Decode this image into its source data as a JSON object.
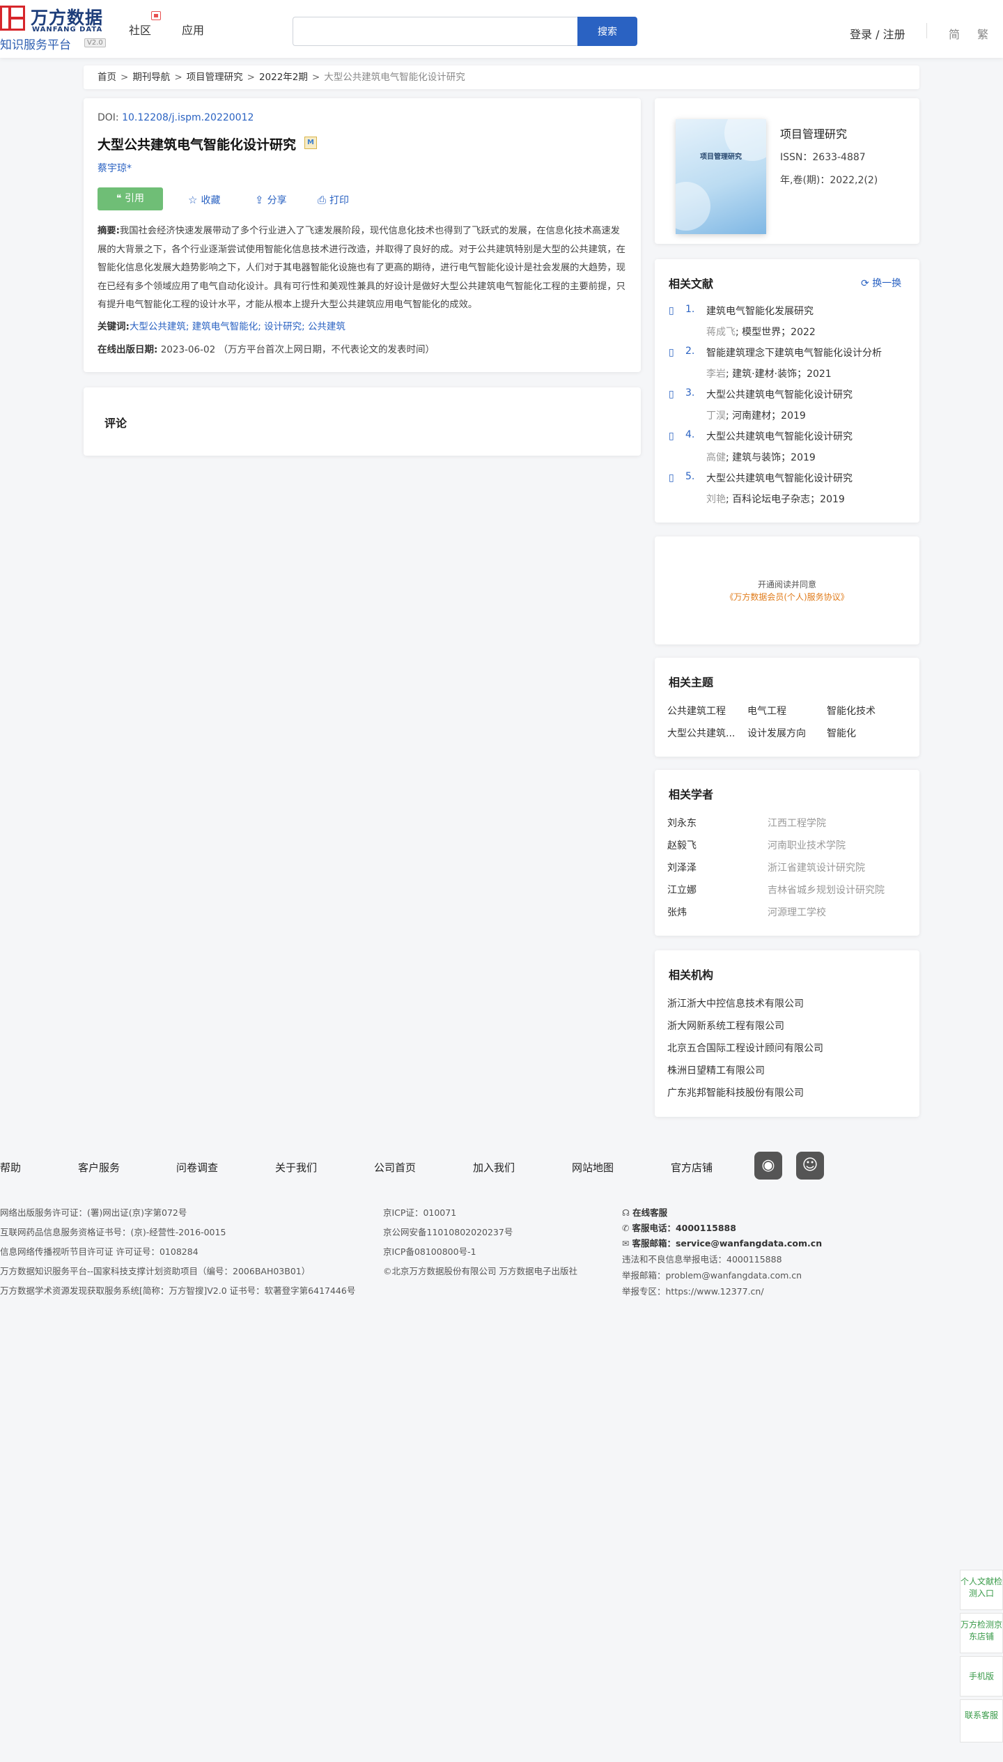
{
  "header": {
    "logo_cn": "万方数据",
    "logo_en": "WANFANG DATA",
    "logo_sub": "知识服务平台",
    "logo_ver": "V2.0",
    "nav": [
      "社区",
      "应用"
    ],
    "search_placeholder": "",
    "search_btn": "搜索",
    "login": "登录 / 注册",
    "lang": [
      "简",
      "繁"
    ]
  },
  "breadcrumb": {
    "items": [
      "首页",
      "期刊导航",
      "项目管理研究",
      "2022年2期"
    ],
    "sep": ">",
    "current": "大型公共建筑电气智能化设计研究"
  },
  "article": {
    "doi_label": "DOI:",
    "doi": "10.12208/j.ispm.20220012",
    "title": "大型公共建筑电气智能化设计研究",
    "m_badge": "M",
    "author": "蔡宇琼*",
    "cite": "引用",
    "collect": "收藏",
    "share": "分享",
    "print": "打印",
    "abstract_label": "摘要:",
    "abstract": "我国社会经济快速发展带动了多个行业进入了飞速发展阶段，现代信息化技术也得到了飞跃式的发展，在信息化技术高速发展的大背景之下，各个行业逐渐尝试使用智能化信息技术进行改造，并取得了良好的成。对于公共建筑特别是大型的公共建筑，在智能化信息化发展大趋势影响之下，人们对于其电器智能化设施也有了更高的期待，进行电气智能化设计是社会发展的大趋势，现在已经有多个领域应用了电气自动化设计。具有可行性和美观性兼具的好设计是做好大型公共建筑电气智能化工程的主要前提，只有提升电气智能化工程的设计水平，才能从根本上提升大型公共建筑应用电气智能化的成效。",
    "kw_label": "关键词:",
    "keywords": [
      "大型公共建筑",
      "建筑电气智能化",
      "设计研究",
      "公共建筑"
    ],
    "kw_seps": [
      "; ",
      "; ",
      "; "
    ],
    "date_label": "在线出版日期:",
    "date": "2023-06-02",
    "date_note": "（万方平台首次上网日期，不代表论文的发表时间）"
  },
  "comment": {
    "title": "评论"
  },
  "journal": {
    "cover_text": "项目管理研究",
    "name": "项目管理研究",
    "issn": "ISSN：2633-4887",
    "volume": "年,卷(期)：2022,2(2)"
  },
  "related": {
    "title": "相关文献",
    "refresh": "换一换",
    "items": [
      {
        "no": "1.",
        "title": "建筑电气智能化发展研究",
        "author": "蒋成飞",
        "source": "; 模型世界；2022"
      },
      {
        "no": "2.",
        "title": "智能建筑理念下建筑电气智能化设计分析",
        "author": "李岩",
        "source": "; 建筑·建材·装饰；2021"
      },
      {
        "no": "3.",
        "title": "大型公共建筑电气智能化设计研究",
        "author": "丁淏",
        "source": "; 河南建材；2019"
      },
      {
        "no": "4.",
        "title": "大型公共建筑电气智能化设计研究",
        "author": "高健",
        "source": "; 建筑与装饰；2019"
      },
      {
        "no": "5.",
        "title": "大型公共建筑电气智能化设计研究",
        "author": "刘艳",
        "source": "; 百科论坛电子杂志；2019"
      }
    ]
  },
  "ad": {
    "line1": "开通阅读并同意",
    "line2": "《万方数据会员(个人)服务协议》"
  },
  "topics": {
    "title": "相关主题",
    "items": [
      "公共建筑工程",
      "电气工程",
      "智能化技术",
      "大型公共建筑...",
      "设计发展方向",
      "智能化"
    ]
  },
  "scholars": {
    "title": "相关学者",
    "items": [
      {
        "name": "刘永东",
        "org": "江西工程学院"
      },
      {
        "name": "赵毅飞",
        "org": "河南职业技术学院"
      },
      {
        "name": "刘泽泽",
        "org": "浙江省建筑设计研究院"
      },
      {
        "name": "江立娜",
        "org": "吉林省城乡规划设计研究院"
      },
      {
        "name": "张炜",
        "org": "河源理工学校"
      }
    ]
  },
  "orgs": {
    "title": "相关机构",
    "items": [
      "浙江浙大中控信息技术有限公司",
      "浙大网新系统工程有限公司",
      "北京五合国际工程设计顾问有限公司",
      "株洲日望精工有限公司",
      "广东兆邦智能科技股份有限公司"
    ]
  },
  "footer": {
    "nav": [
      "帮助",
      "客户服务",
      "问卷调查",
      "关于我们",
      "公司首页",
      "加入我们",
      "网站地图",
      "官方店铺"
    ],
    "col1": [
      "网络出版服务许可证：(署)网出证(京)字第072号",
      "互联网药品信息服务资格证书号：(京)-经营性-2016-0015",
      "信息网络传播视听节目许可证 许可证号：0108284",
      "万方数据知识服务平台--国家科技支撑计划资助项目（编号：2006BAH03B01）",
      "万方数据学术资源发现获取服务系统[简称：万方智搜]V2.0 证书号：软著登字第6417446号"
    ],
    "col2": [
      "京ICP证：010071",
      "京公网安备11010802020237号",
      "京ICP备08100800号-1",
      "©北京万方数据股份有限公司 万方数据电子出版社"
    ],
    "online": "在线客服",
    "phone_label": "客服电话：",
    "phone": "4000115888",
    "email_label": "客服邮箱：",
    "email": "service@wanfangdata.com.cn",
    "report1": "违法和不良信息举报电话：4000115888",
    "report2": "举报邮箱：problem@wanfangdata.com.cn",
    "report3": "举报专区：https://www.12377.cn/"
  },
  "float": {
    "items": [
      "个人文献检测入口",
      "万方检测京东店铺",
      "手机版",
      "联系客服"
    ]
  }
}
